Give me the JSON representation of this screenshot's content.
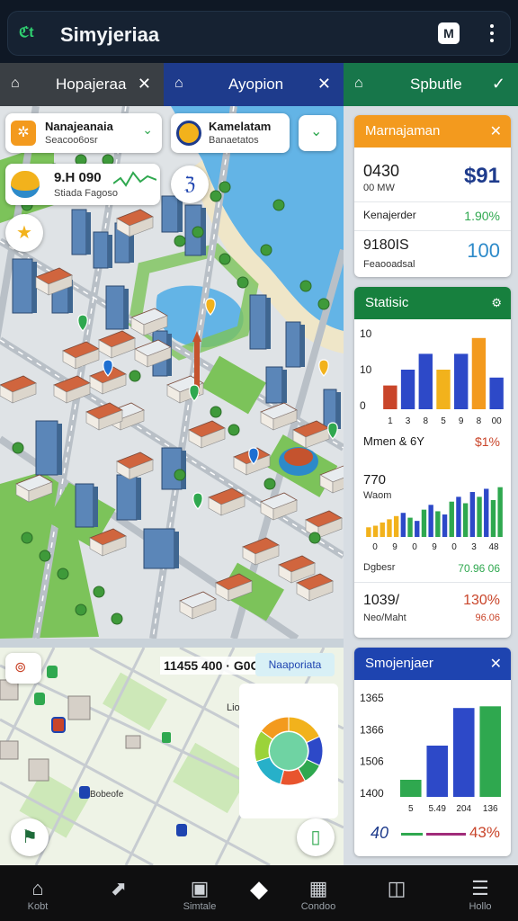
{
  "app": {
    "title": "Simyjeriaa",
    "logo_text": "ℭt",
    "accent": "#2fcf70"
  },
  "top_actions": {
    "square_glyph": "M"
  },
  "tabs": [
    {
      "label": "Hopajeraa",
      "icon": "home-outline-icon",
      "close": "✕",
      "color": "#3a3f44"
    },
    {
      "label": "Ayopion",
      "icon": "home-outline-icon",
      "close": "✕",
      "color": "#1e3b8c"
    },
    {
      "label": "Spbutle",
      "icon": "home-outline-icon",
      "close": "✓",
      "color": "#17764a"
    }
  ],
  "map_chips": {
    "chip1": {
      "title": "Nanajeanaia",
      "sub": "Seacoo6osr"
    },
    "chip2": {
      "title": "Kamelatam",
      "sub": "Banaetatos"
    },
    "chip3": {
      "title": "9.H 090",
      "sub": "Stiada Fagoso"
    },
    "bottom_chip": {
      "text": "11455 400 · G0C",
      "badge": "Naaporiata"
    }
  },
  "cards": {
    "manajaman": {
      "title": "Marnajaman",
      "color": "#f39a1e",
      "row1_label": "0430",
      "row1_sub": "00 MW",
      "row1_value": "$91",
      "row2_label": "Kenajerder",
      "row2_value": "1.90%",
      "row3_label": "9180IS",
      "row3_sub": "Feaooadsal",
      "row3_value": "100"
    },
    "statisic": {
      "title": "Statisic",
      "color": "#17803e",
      "chart1_title": "10",
      "chart2_title": "770",
      "chart2_sub": "Waom",
      "row1_label": "Mmen & 6Y",
      "row1_value": "$1%",
      "row2_label": "Dgbesr",
      "row2_value": "70.96 06",
      "row3_label": "1039/",
      "row3_sub": "Neo/Maht",
      "row3_value": "130%",
      "row3_sub_value": "96.06"
    },
    "simojenjaer": {
      "title": "Smojenjaer",
      "color": "#1e44b0",
      "footer_left": "40",
      "footer_right": "43%"
    }
  },
  "chart_data": [
    {
      "type": "bar",
      "title": "",
      "categories": [
        "1",
        "3",
        "8",
        "5",
        "9",
        "8",
        "00"
      ],
      "y_ticks": [
        "10",
        "10",
        "0"
      ],
      "values": [
        3,
        5,
        7,
        5,
        7,
        9,
        4
      ],
      "colors": [
        "#c9452a",
        "#2d49c8",
        "#2d49c8",
        "#f2b21c",
        "#2d49c8",
        "#f39a1e",
        "#2d49c8"
      ],
      "ylim": [
        0,
        10
      ]
    },
    {
      "type": "bar",
      "title": "770",
      "categories": [
        "0",
        "9",
        "0",
        "9",
        "0",
        "3",
        "48"
      ],
      "values": [
        1.2,
        1.4,
        1.8,
        2.2,
        2.6,
        3.0,
        2.4,
        2.0,
        3.4,
        4.0,
        3.2,
        2.8,
        4.4,
        5.0,
        4.2,
        5.6,
        5.0,
        6.0,
        4.6,
        6.2
      ],
      "colors": [
        "#f2b21c",
        "#f2b21c",
        "#f2b21c",
        "#f2b21c",
        "#f2b21c",
        "#2d49c8",
        "#2fa84f",
        "#2d49c8",
        "#2fa84f",
        "#2d49c8",
        "#2fa84f",
        "#2d49c8",
        "#2fa84f",
        "#2d49c8",
        "#2fa84f",
        "#2d49c8",
        "#2fa84f",
        "#2d49c8",
        "#2fa84f",
        "#2fa84f"
      ],
      "ylim": [
        0,
        6.5
      ]
    },
    {
      "type": "bar",
      "title": "",
      "categories": [
        "5",
        "5.49",
        "204",
        "136"
      ],
      "y_ticks": [
        "1365",
        "1366",
        "1506",
        "1400"
      ],
      "values": [
        1,
        3,
        5.2,
        5.3
      ],
      "colors": [
        "#2fa84f",
        "#2d49c8",
        "#2d49c8",
        "#2fa84f"
      ],
      "ylim": [
        0,
        6
      ]
    },
    {
      "type": "pie",
      "title": "",
      "values": [
        18,
        14,
        10,
        12,
        16,
        15,
        15
      ],
      "colors": [
        "#f2b21c",
        "#2d49c8",
        "#2fa84f",
        "#e8542e",
        "#27b0c9",
        "#9bd33a",
        "#f39a1e"
      ]
    }
  ],
  "nav": [
    {
      "label": "Kobt",
      "icon": "home-icon"
    },
    {
      "label": "",
      "icon": "map-marker-icon"
    },
    {
      "label": "Simtale",
      "icon": "building-icon"
    },
    {
      "label": "",
      "icon": "diamond-icon"
    },
    {
      "label": "Condoo",
      "icon": "city-icon"
    },
    {
      "label": "",
      "icon": "layout-icon"
    },
    {
      "label": "Hollo",
      "icon": "menu-icon"
    }
  ]
}
